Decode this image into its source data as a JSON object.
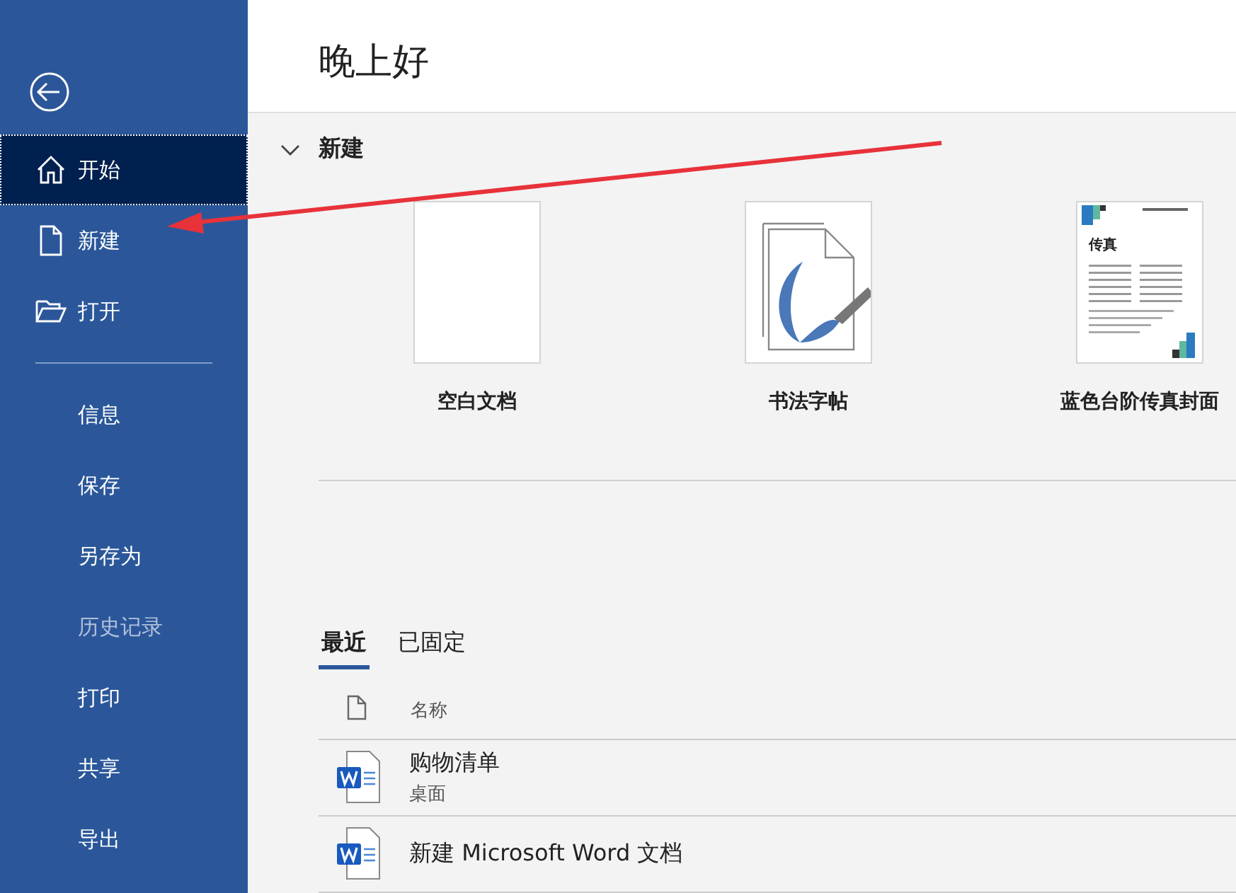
{
  "greeting": "晚上好",
  "sidebar": {
    "primary_items": [
      {
        "label": "开始",
        "kind": "home",
        "selected": true,
        "disabled": false
      },
      {
        "label": "新建",
        "kind": "file",
        "selected": false,
        "disabled": false
      },
      {
        "label": "打开",
        "kind": "folder",
        "selected": false,
        "disabled": false
      }
    ],
    "secondary_items": [
      {
        "label": "信息",
        "selected": false,
        "disabled": false
      },
      {
        "label": "保存",
        "selected": false,
        "disabled": false
      },
      {
        "label": "另存为",
        "selected": false,
        "disabled": false
      },
      {
        "label": "历史记录",
        "selected": false,
        "disabled": true
      },
      {
        "label": "打印",
        "selected": false,
        "disabled": false
      },
      {
        "label": "共享",
        "selected": false,
        "disabled": false
      },
      {
        "label": "导出",
        "selected": false,
        "disabled": false
      }
    ]
  },
  "new_section": {
    "title": "新建",
    "expanded": true,
    "templates": [
      {
        "title": "空白文档",
        "kind": "blank"
      },
      {
        "title": "书法字帖",
        "kind": "calligraphy"
      },
      {
        "title": "蓝色台阶传真封面",
        "kind": "fax",
        "heading": "传真"
      }
    ]
  },
  "tabs": [
    {
      "label": "最近",
      "selected": true
    },
    {
      "label": "已固定",
      "selected": false
    }
  ],
  "table": {
    "columns": [
      "名称"
    ],
    "rows": [
      {
        "name": "购物清单",
        "location": "桌面"
      },
      {
        "name": "新建 Microsoft Word 文档"
      }
    ]
  }
}
